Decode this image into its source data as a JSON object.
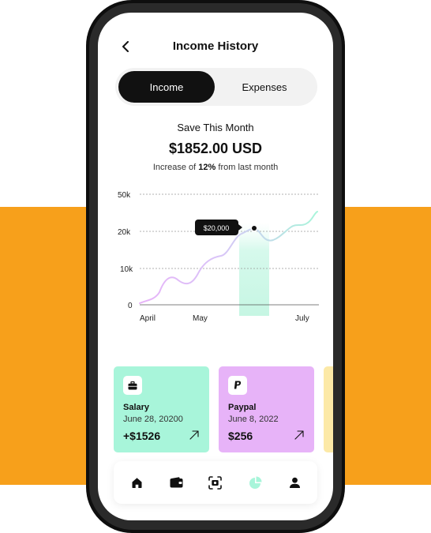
{
  "screen": {
    "title": "Income History"
  },
  "tabs": [
    {
      "label": "Income",
      "active": true
    },
    {
      "label": "Expenses",
      "active": false
    }
  ],
  "summary": {
    "label": "Save This Month",
    "amount": "$1852.00 USD",
    "increase_prefix": "Increase of ",
    "increase_value": "12%",
    "increase_suffix": " from last month"
  },
  "chart_data": {
    "type": "line",
    "y_ticks": [
      "50k",
      "20k",
      "10k",
      "0"
    ],
    "x_ticks": [
      "April",
      "May",
      "July"
    ],
    "tooltip": "$20,000",
    "highlight_month": "June",
    "colors": {
      "line_start": "#E7B3F8",
      "line_end": "#A8F5DA",
      "highlight": "#D6F9EC",
      "tooltip_bg": "#111111"
    }
  },
  "cards": [
    {
      "name": "Salary",
      "date": "June 28, 20200",
      "amount": "+$1526",
      "icon": "briefcase-icon",
      "color": "#A8F5DA"
    },
    {
      "name": "Paypal",
      "date": "June 8, 2022",
      "amount": "$256",
      "icon": "paypal-icon",
      "color": "#E7B3F8"
    }
  ],
  "nav": {
    "items": [
      "home-icon",
      "wallet-icon",
      "scan-icon",
      "chart-pie-icon",
      "profile-icon"
    ],
    "active": "chart-pie-icon",
    "active_color": "#A8F5DA"
  },
  "colors": {
    "background_band": "#F7A01B",
    "phone_frame": "#0e0e0e"
  }
}
